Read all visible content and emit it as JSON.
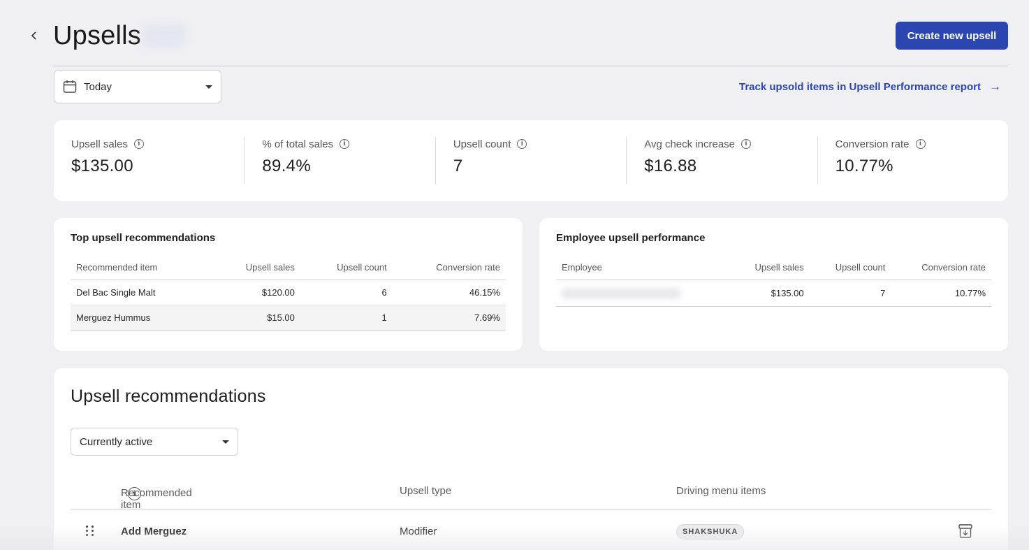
{
  "header": {
    "title": "Upsells",
    "create_button": "Create new upsell"
  },
  "filters": {
    "date_range": "Today"
  },
  "track_link": {
    "label": "Track upsold items in Upsell Performance report",
    "arrow": "→"
  },
  "stats": [
    {
      "label": "Upsell sales",
      "value": "$135.00"
    },
    {
      "label": "% of total sales",
      "value": "89.4%"
    },
    {
      "label": "Upsell count",
      "value": "7"
    },
    {
      "label": "Avg check increase",
      "value": "$16.88"
    },
    {
      "label": "Conversion rate",
      "value": "10.77%"
    }
  ],
  "top_recommendations": {
    "title": "Top upsell recommendations",
    "columns": [
      "Recommended item",
      "Upsell sales",
      "Upsell count",
      "Conversion rate"
    ],
    "rows": [
      {
        "item": "Del Bac Single Malt",
        "sales": "$120.00",
        "count": "6",
        "rate": "46.15%"
      },
      {
        "item": "Merguez Hummus",
        "sales": "$15.00",
        "count": "1",
        "rate": "7.69%"
      }
    ]
  },
  "employee_performance": {
    "title": "Employee upsell performance",
    "columns": [
      "Employee",
      "Upsell sales",
      "Upsell count",
      "Conversion rate"
    ],
    "rows": [
      {
        "sales": "$135.00",
        "count": "7",
        "rate": "10.77%"
      }
    ]
  },
  "recommendations": {
    "title": "Upsell recommendations",
    "status_filter": "Currently active",
    "columns": [
      "Recommended item",
      "Upsell type",
      "Driving menu items"
    ],
    "rows": [
      {
        "item": "Add Merguez",
        "type": "Modifier",
        "driving_items": [
          "SHAKSHUKA"
        ]
      }
    ]
  },
  "icons": {
    "back": "chevron-left-icon",
    "calendar": "calendar-icon",
    "info": "info-icon",
    "drag": "drag-handle-icon",
    "archive": "archive-icon"
  },
  "colors": {
    "accent": "#2b46b1",
    "background": "#f0f0f2"
  }
}
